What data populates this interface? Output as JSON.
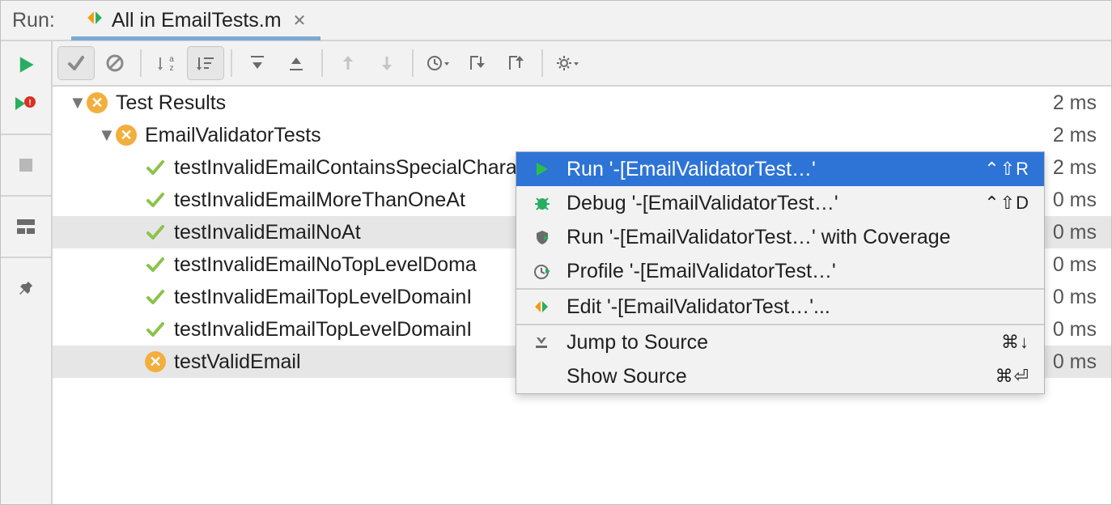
{
  "titlebar": {
    "label": "Run:",
    "tab_label": "All in EmailTests.m"
  },
  "sidebar": {
    "buttons": [
      {
        "name": "run-icon"
      },
      {
        "name": "run-failed-icon"
      },
      {
        "name": "divider"
      },
      {
        "name": "stop-icon"
      },
      {
        "name": "divider"
      },
      {
        "name": "layout-icon"
      },
      {
        "name": "divider"
      },
      {
        "name": "pin-icon"
      }
    ]
  },
  "toolbar": {
    "buttons": [
      {
        "name": "show-passed-icon",
        "on": true
      },
      {
        "name": "show-ignored-icon"
      },
      {
        "name": "sort-alpha-icon"
      },
      {
        "name": "sort-duration-icon",
        "on": true
      },
      {
        "name": "expand-all-icon"
      },
      {
        "name": "collapse-all-icon"
      },
      {
        "name": "prev-failed-icon",
        "disabled": true
      },
      {
        "name": "next-failed-icon",
        "disabled": true
      },
      {
        "name": "history-icon",
        "dropdown": true
      },
      {
        "name": "import-icon"
      },
      {
        "name": "export-icon"
      },
      {
        "name": "settings-icon",
        "dropdown": true
      }
    ]
  },
  "tree": {
    "rows": [
      {
        "indent": 0,
        "disclosure": true,
        "status": "fail",
        "label": "Test Results",
        "duration": "2 ms",
        "name": "root"
      },
      {
        "indent": 1,
        "disclosure": true,
        "status": "fail",
        "label": "EmailValidatorTests",
        "duration": "2 ms",
        "name": "suite-emailvalidatortests"
      },
      {
        "indent": 2,
        "status": "pass",
        "label": "testInvalidEmailContainsSpecialCharacters",
        "duration": "2 ms",
        "name": "test-1"
      },
      {
        "indent": 2,
        "status": "pass",
        "label": "testInvalidEmailMoreThanOneAt",
        "duration": "0 ms",
        "name": "test-2"
      },
      {
        "indent": 2,
        "status": "pass",
        "label": "testInvalidEmailNoAt",
        "duration": "0 ms",
        "name": "test-3",
        "selected": true
      },
      {
        "indent": 2,
        "status": "pass",
        "label": "testInvalidEmailNoTopLevelDoma",
        "duration": "0 ms",
        "name": "test-4"
      },
      {
        "indent": 2,
        "status": "pass",
        "label": "testInvalidEmailTopLevelDomainI",
        "duration": "0 ms",
        "name": "test-5"
      },
      {
        "indent": 2,
        "status": "pass",
        "label": "testInvalidEmailTopLevelDomainI",
        "duration": "0 ms",
        "name": "test-6"
      },
      {
        "indent": 2,
        "status": "fail",
        "label": "testValidEmail",
        "duration": "0 ms",
        "name": "test-7",
        "selected": true
      }
    ]
  },
  "menu": {
    "items": [
      {
        "icon": "run-icon",
        "label": "Run '-[EmailValidatorTest…'",
        "shortcut": "⌃⇧R",
        "selected": true
      },
      {
        "icon": "debug-icon",
        "label": "Debug '-[EmailValidatorTest…'",
        "shortcut": "⌃⇧D"
      },
      {
        "icon": "coverage-icon",
        "label": "Run '-[EmailValidatorTest…' with Coverage"
      },
      {
        "icon": "profile-icon",
        "label": "Profile '-[EmailValidatorTest…'"
      },
      {
        "sep": true
      },
      {
        "icon": "edit-config-icon",
        "label": "Edit '-[EmailValidatorTest…'..."
      },
      {
        "sep": true
      },
      {
        "icon": "jump-source-icon",
        "label": "Jump to Source",
        "shortcut": "⌘↓"
      },
      {
        "icon": "blank",
        "label": "Show Source",
        "shortcut": "⌘⏎"
      }
    ]
  }
}
